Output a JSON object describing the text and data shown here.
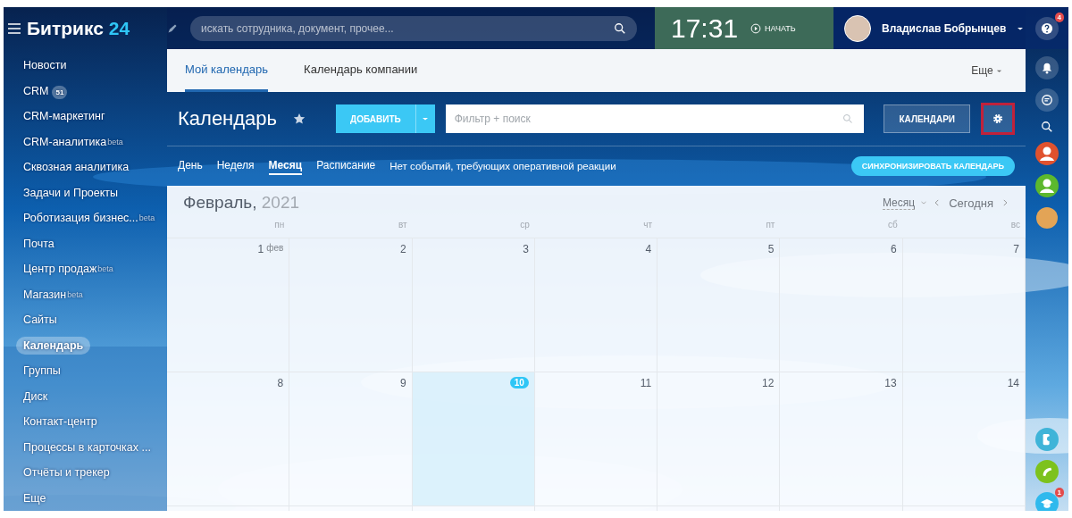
{
  "logo": {
    "name": "Битрикс",
    "number": "24"
  },
  "search": {
    "placeholder": "искать сотрудника, документ, прочее..."
  },
  "clock": {
    "time": "17:31",
    "start": "НАЧАТЬ"
  },
  "user": {
    "name": "Владислав Бобрынцев"
  },
  "sidebar": {
    "items": [
      {
        "label": "Новости",
        "selected": false
      },
      {
        "label": "CRM",
        "badge": "51",
        "selected": false
      },
      {
        "label": "CRM-маркетинг",
        "selected": false
      },
      {
        "label": "CRM-аналитика",
        "sup": "beta",
        "selected": false
      },
      {
        "label": "Сквозная аналитика",
        "selected": false
      },
      {
        "label": "Задачи и Проекты",
        "selected": false
      },
      {
        "label": "Роботизация бизнес...",
        "sup": "beta",
        "selected": false
      },
      {
        "label": "Почта",
        "selected": false
      },
      {
        "label": "Центр продаж",
        "sup": "beta",
        "selected": false
      },
      {
        "label": "Магазин",
        "sup": "beta",
        "selected": false
      },
      {
        "label": "Сайты",
        "selected": false
      },
      {
        "label": "Календарь",
        "selected": true
      },
      {
        "label": "Группы",
        "selected": false
      },
      {
        "label": "Диск",
        "selected": false
      },
      {
        "label": "Контакт-центр",
        "selected": false
      },
      {
        "label": "Процессы в карточках ...",
        "selected": false
      },
      {
        "label": "Отчёты и трекер",
        "selected": false
      },
      {
        "label": "Еще",
        "selected": false
      }
    ]
  },
  "tabs": [
    {
      "label": "Мой календарь",
      "selected": true
    },
    {
      "label": "Календарь компании",
      "selected": false
    }
  ],
  "more": "Еще",
  "toolbar": {
    "title": "Календарь",
    "add": "ДОБАВИТЬ",
    "filter_placeholder": "Фильтр + поиск",
    "calendars": "КАЛЕНДАРИ",
    "settings_highlighted": true
  },
  "views": [
    {
      "label": "День",
      "selected": false
    },
    {
      "label": "Неделя",
      "selected": false
    },
    {
      "label": "Месяц",
      "selected": true
    },
    {
      "label": "Расписание",
      "selected": false
    }
  ],
  "notice": "Нет событий, требующих оперативной реакции",
  "sync": "СИНХРОНИЗИРОВАТЬ КАЛЕНДАРЬ",
  "calendar": {
    "month": "Февраль,",
    "year": "2021",
    "view_select": "Месяц",
    "today": "Сегодня",
    "weekdays": [
      "пн",
      "вт",
      "ср",
      "чт",
      "пт",
      "сб",
      "вс"
    ],
    "weeks": [
      [
        {
          "day": "1",
          "suffix": "фев",
          "today": false
        },
        {
          "day": "2",
          "today": false
        },
        {
          "day": "3",
          "today": false
        },
        {
          "day": "4",
          "today": false
        },
        {
          "day": "5",
          "today": false
        },
        {
          "day": "6",
          "today": false
        },
        {
          "day": "7",
          "today": false
        }
      ],
      [
        {
          "day": "8",
          "today": false
        },
        {
          "day": "9",
          "today": false
        },
        {
          "day": "10",
          "today": true
        },
        {
          "day": "11",
          "today": false
        },
        {
          "day": "12",
          "today": false
        },
        {
          "day": "13",
          "today": false
        },
        {
          "day": "14",
          "today": false
        }
      ],
      [
        {
          "today": false
        },
        {
          "today": false
        },
        {
          "today": false
        },
        {
          "today": false
        },
        {
          "today": false
        },
        {
          "today": false
        },
        {
          "today": false
        }
      ]
    ]
  },
  "rightbar": {
    "help_badge": "4",
    "learning_badge": "1"
  }
}
